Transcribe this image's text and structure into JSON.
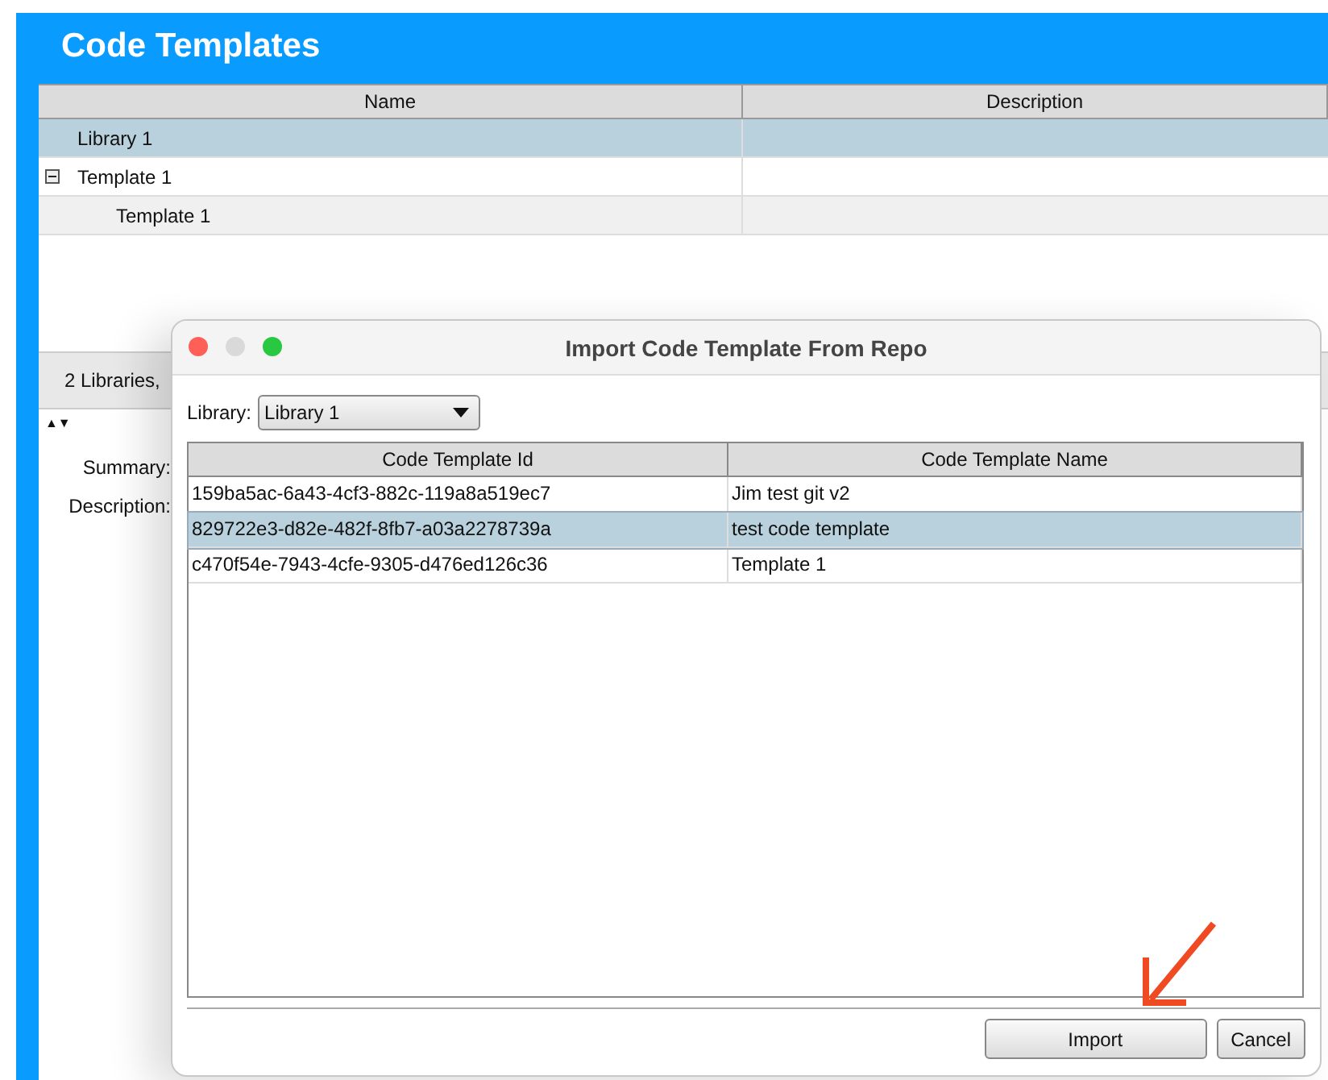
{
  "app": {
    "title": "Code Templates",
    "tree_columns": [
      "Name",
      "Description"
    ],
    "tree": [
      {
        "label": "Library 1",
        "selected": true
      },
      {
        "label": "Template 1",
        "selected": false,
        "expanded": true,
        "children": [
          {
            "label": "Template 1",
            "selected": false
          }
        ]
      }
    ],
    "status": "2 Libraries,",
    "sort_arrows": "▲▼",
    "fields": [
      "Summary:",
      "Description:"
    ]
  },
  "dialog": {
    "title": "Import Code Template From Repo",
    "library_label": "Library:",
    "library_value": "Library 1",
    "columns": [
      "Code Template Id",
      "Code Template Name"
    ],
    "rows": [
      {
        "id": "159ba5ac-6a43-4cf3-882c-119a8a519ec7",
        "name": "Jim test git v2",
        "selected": false
      },
      {
        "id": "829722e3-d82e-482f-8fb7-a03a2278739a",
        "name": "test code template",
        "selected": true
      },
      {
        "id": "c470f54e-7943-4cfe-9305-d476ed126c36",
        "name": "Template 1",
        "selected": false
      }
    ],
    "buttons": [
      "Import",
      "Cancel"
    ]
  }
}
